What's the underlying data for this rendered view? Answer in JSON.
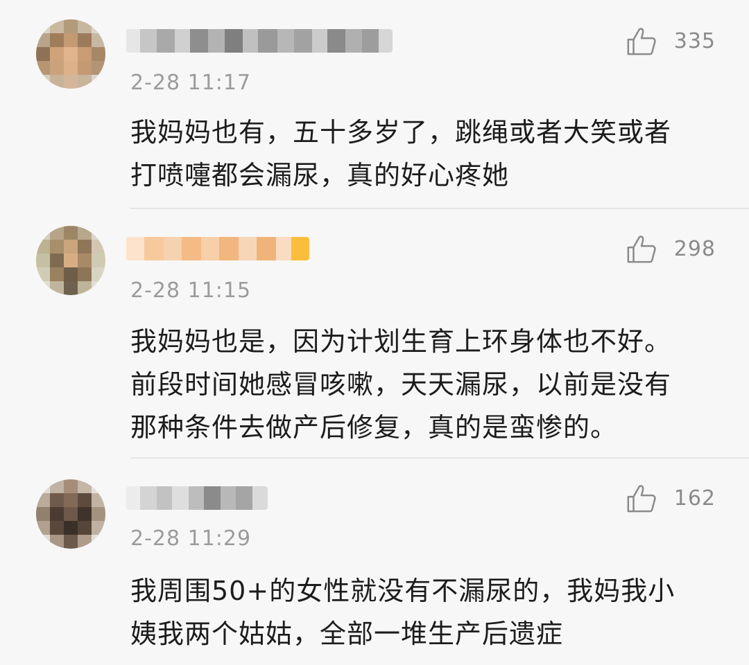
{
  "comments": [
    {
      "time": "2-28 11:17",
      "likes": "335",
      "text": "我妈妈也有，五十多岁了，跳绳或者大笑或者\n打喷嚏都会漏尿，真的好心疼她",
      "username_blurred": true,
      "avatar_blurred": true
    },
    {
      "time": "2-28 11:15",
      "likes": "298",
      "text": "我妈妈也是，因为计划生育上环身体也不好。\n前段时间她感冒咳嗽，天天漏尿，以前是没有\n那种条件去做产后修复，真的是蛮惨的。",
      "username_blurred": true,
      "avatar_blurred": true
    },
    {
      "time": "2-28 11:29",
      "likes": "162",
      "text": "我周围50+的女性就没有不漏尿的，我妈我小\n姨我两个姑姑，全部一堆生产后遗症",
      "username_blurred": true,
      "avatar_blurred": true
    }
  ],
  "icons": {
    "like": "thumbs-up-icon"
  },
  "colors": {
    "background": "#f7f7f7",
    "text": "#1c1c1c",
    "meta": "#9b9b9b",
    "divider": "#e4e4e4"
  }
}
